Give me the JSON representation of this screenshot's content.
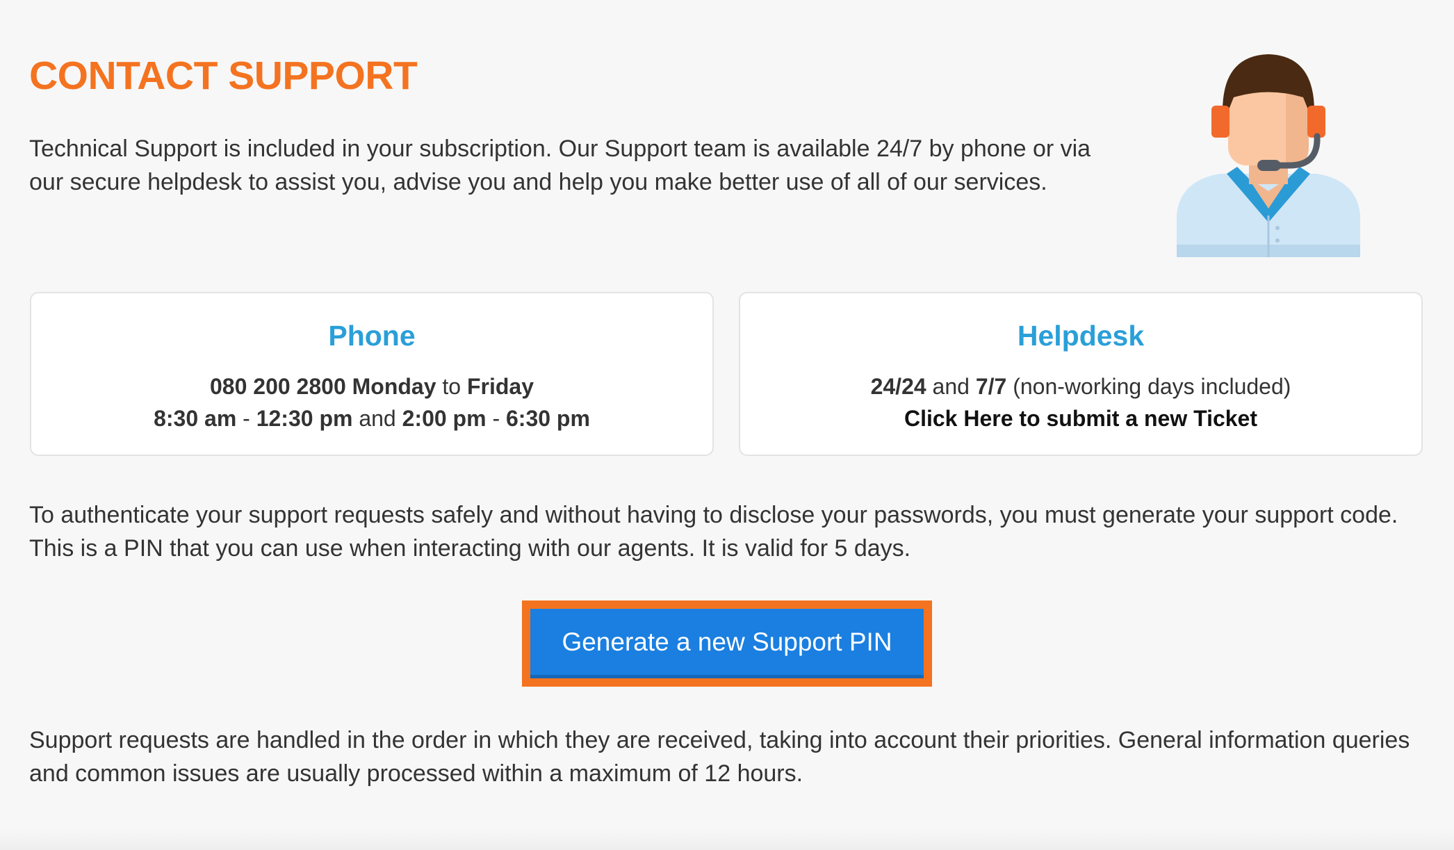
{
  "header": {
    "title": "CONTACT SUPPORT"
  },
  "intro": {
    "text": "Technical Support is included in your subscription. Our Support team is available 24/7 by phone or via our secure helpdesk to assist you, advise you and help you make better use of all of our services."
  },
  "illustration": {
    "icon": "support-agent-headset-icon"
  },
  "phone_card": {
    "title": "Phone",
    "number": "080 200 2800",
    "day_from": "Monday",
    "to_word": "to",
    "day_to": "Friday",
    "morning_start": "8:30 am",
    "dash": "-",
    "morning_end": "12:30 pm",
    "and_word": "and",
    "afternoon_start": "2:00 pm",
    "afternoon_end": "6:30 pm"
  },
  "helpdesk_card": {
    "title": "Helpdesk",
    "hours": "24/24",
    "and_word": "and",
    "days": "7/7",
    "note": "(non-working days included)",
    "link_text": "Click Here to submit a new Ticket"
  },
  "auth": {
    "text": "To authenticate your support requests safely and without having to disclose your passwords, you must generate your support code. This is a PIN that you can use when interacting with our agents. It is valid for 5 days."
  },
  "pin_button": {
    "label": "Generate a new Support PIN"
  },
  "footer": {
    "text": "Support requests are handled in the order in which they are received, taking into account their priorities. General information queries and common issues are usually processed within a maximum of 12 hours."
  },
  "colors": {
    "accent_orange": "#f47320",
    "card_title_blue": "#2a9fd8",
    "button_blue": "#1a7fe0",
    "background": "#f7f7f7"
  }
}
